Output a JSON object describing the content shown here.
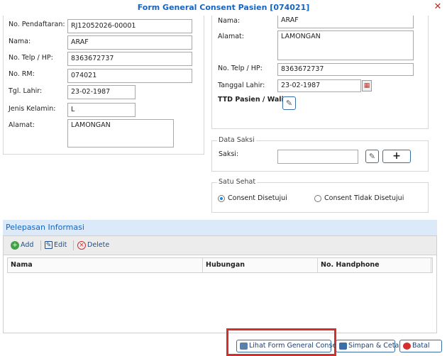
{
  "window": {
    "title": "Form General Consent Pasien [074021]",
    "close_icon": "close-icon"
  },
  "patient": {
    "no_pendaftaran_label": "No. Pendaftaran:",
    "no_pendaftaran": "RJ12052026-00001",
    "nama_label": "Nama:",
    "nama": "ARAF",
    "telp_label": "No. Telp / HP:",
    "telp": "8363672737",
    "rm_label": "No. RM:",
    "rm": "074021",
    "tgl_lahir_label": "Tgl. Lahir:",
    "tgl_lahir": "23-02-1987",
    "jk_label": "Jenis Kelamin:",
    "jk": "L",
    "alamat_label": "Alamat:",
    "alamat": "LAMONGAN"
  },
  "wali": {
    "nama_label": "Nama:",
    "nama": "ARAF",
    "alamat_label": "Alamat:",
    "alamat": "LAMONGAN",
    "telp_label": "No. Telp / HP:",
    "telp": "8363672737",
    "tanggal_label": "Tanggal Lahir:",
    "tanggal": "23-02-1987",
    "ttd_label": "TTD Pasien / Wali :"
  },
  "saksi": {
    "legend": "Data Saksi",
    "label": "Saksi:",
    "value": "",
    "add_label": "+"
  },
  "satu_sehat": {
    "legend": "Satu Sehat",
    "option_yes": "Consent Disetujui",
    "option_no": "Consent Tidak Disetujui",
    "selected": "Consent Disetujui"
  },
  "pelepasan": {
    "title": "Pelepasan Informasi",
    "toolbar": {
      "add": "Add",
      "edit": "Edit",
      "delete": "Delete"
    },
    "columns": [
      "Nama",
      "Hubungan",
      "No. Handphone"
    ],
    "rows": []
  },
  "footer": {
    "lihat": "Lihat Form General Consent",
    "simpan": "Simpan & Cetak",
    "batal": "Batal"
  },
  "colors": {
    "accent": "#1565c0",
    "highlight": "#d32f2f",
    "section_bg": "#dce9f8"
  }
}
